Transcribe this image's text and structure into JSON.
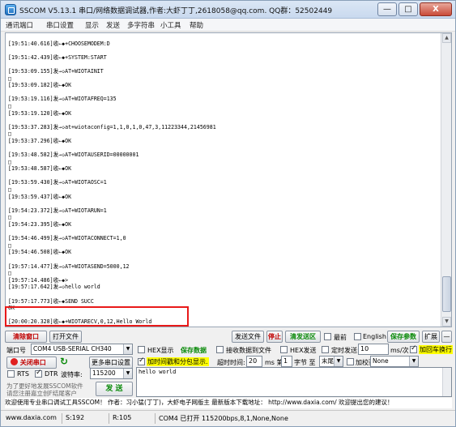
{
  "window": {
    "title": "SSCOM V5.13.1 串口/网络数据调试器,作者:大虾丁丁,2618058@qq.com. QQ群：52502449",
    "minimize": "—",
    "maximize": "□",
    "close": "X"
  },
  "menu": [
    "通讯端口",
    "串口设置",
    "显示",
    "发送",
    "多字符串",
    "小工具",
    "帮助"
  ],
  "receive_lines": [
    "",
    "[19:51:40.616]收←◆+CHOOSEMODEM:D",
    "",
    "[19:51:42.439]收←◆+SYSTEM:START",
    "",
    "[19:53:09.155]发→◇AT+WIOTAINIT",
    "□",
    "[19:53:09.182]收←◆OK",
    "",
    "[19:53:19.116]发→◇AT+WIOTAFREQ=135",
    "□",
    "[19:53:19.120]收←◆OK",
    "",
    "[19:53:37.283]发→◇at+wiotaconfig=1,1,0,1,0,47,3,11223344,21456981",
    "□",
    "[19:53:37.296]收←◆OK",
    "",
    "[19:53:48.582]发→◇AT+WIOTAUSERID=00000001",
    "□",
    "[19:53:48.587]收←◆OK",
    "",
    "[19:53:59.430]发→◇AT+WIOTAOSC=1",
    "□",
    "[19:53:59.437]收←◆OK",
    "",
    "[19:54:23.372]发→◇AT+WIOTARUN=1",
    "□",
    "[19:54:23.395]收←◆OK",
    "",
    "[19:54:46.499]发→◇AT+WIOTACONNECT=1,0",
    "□",
    "[19:54:46.508]收←◆OK",
    "",
    "[19:57:14.477]发→◇AT+WIOTASEND=5000,12",
    "□",
    "[19:57:14.486]收←◆>",
    "[19:57:17.642]发→◇hello world",
    "",
    "[19:57:17.773]收←◆SEND SUCC",
    "OK",
    "",
    "[20:00:20.328]收←◆+WIOTARECV,0,12,Hello World"
  ],
  "controls": {
    "clear_window": "清除窗口",
    "open_file": "打开文件",
    "send_file": "发送文件",
    "stop": "停止",
    "clear_send": "清发送区",
    "topmost": "最前",
    "english": "English",
    "save_params": "保存参数",
    "expand": "扩展",
    "collapse": "—",
    "port_label": "端口号",
    "port_value": "COM4 USB-SERIAL CH340",
    "hex_display": "HEX显示",
    "save_data": "保存数据",
    "recv_to_file": "接收数据到文件",
    "hex_send": "HEX发送",
    "timed_send": "定时发送:",
    "interval_value": "10",
    "interval_unit": "ms/次",
    "add_crlf": "加回车换行",
    "close_port": "关闭串口",
    "more_settings": "更多串口设置",
    "timestamp_split": "加时间戳和分包显示.",
    "timeout_label": "超时时间:",
    "timeout_value": "20",
    "timeout_unit": "ms 第",
    "byte_index": "1",
    "byte_label": "字节 至",
    "byte_end": "末尾",
    "checksum_label": "加校验",
    "checksum_value": "None",
    "rts": "RTS",
    "dtr": "DTR",
    "baud_label": "波特率:",
    "baud_value": "115200",
    "send_button": "发 送",
    "send_text": "hello world",
    "promo_line1": "为了更好地发展SSCOM软件",
    "promo_line2": "请您注册嘉立创F结尾客户"
  },
  "banner": "欢迎使用专业串口调试工具SSCOM！  作者：习小猛(丁丁)，大虾电子网版主  最新版本下载地址： http://www.daxia.com/  欢迎提出您的建议！",
  "status_bar": {
    "site": "www.daxia.com",
    "sent": "S:192",
    "recv": "R:105",
    "port_status": "COM4 已打开  115200bps,8,1,None,None"
  },
  "colors": {
    "highlight_box": "#e81919",
    "accent_green": "#0a8a0a",
    "stop_red": "#c00000",
    "yellow": "#ffff00"
  }
}
